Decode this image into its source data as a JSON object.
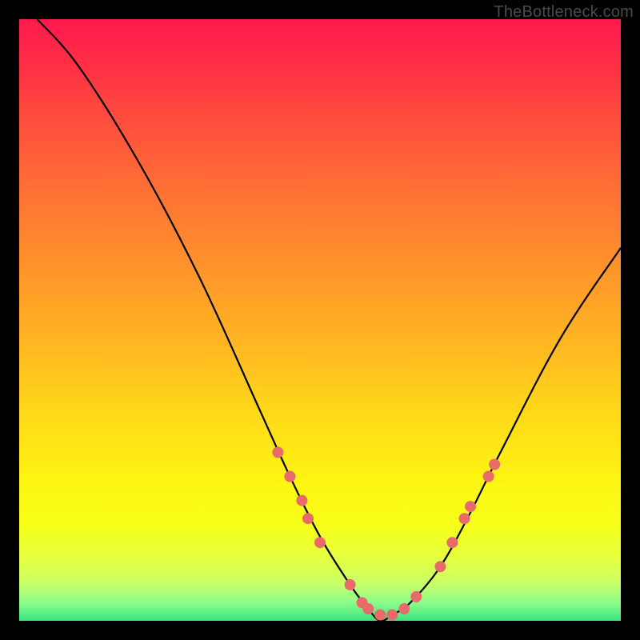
{
  "watermark": "TheBottleneck.com",
  "chart_data": {
    "type": "line",
    "title": "",
    "xlabel": "",
    "ylabel": "",
    "x_range": [
      0,
      100
    ],
    "y_range": [
      0,
      100
    ],
    "series": [
      {
        "name": "curve",
        "description": "V-shaped bottleneck curve; y≈0 near x≈60, rising steeply toward x=0 and more gently toward x=100",
        "x": [
          3,
          10,
          20,
          30,
          40,
          45,
          50,
          55,
          58,
          60,
          62,
          65,
          70,
          75,
          80,
          90,
          100
        ],
        "y": [
          100,
          92,
          76,
          57,
          35,
          24,
          14,
          6,
          2,
          0,
          1,
          3,
          9,
          18,
          28,
          47,
          62
        ]
      }
    ],
    "markers": {
      "name": "highlight-dots",
      "color": "#e86a6a",
      "radius_px": 7,
      "points": [
        {
          "x": 43,
          "y": 28
        },
        {
          "x": 45,
          "y": 24
        },
        {
          "x": 47,
          "y": 20
        },
        {
          "x": 48,
          "y": 17
        },
        {
          "x": 50,
          "y": 13
        },
        {
          "x": 55,
          "y": 6
        },
        {
          "x": 57,
          "y": 3
        },
        {
          "x": 58,
          "y": 2
        },
        {
          "x": 60,
          "y": 1
        },
        {
          "x": 62,
          "y": 1
        },
        {
          "x": 64,
          "y": 2
        },
        {
          "x": 66,
          "y": 4
        },
        {
          "x": 70,
          "y": 9
        },
        {
          "x": 72,
          "y": 13
        },
        {
          "x": 74,
          "y": 17
        },
        {
          "x": 75,
          "y": 19
        },
        {
          "x": 78,
          "y": 24
        },
        {
          "x": 79,
          "y": 26
        }
      ]
    },
    "background_gradient": {
      "top": "#ff1a4c",
      "mid": "#fff312",
      "bottom": "#38e37f"
    }
  }
}
